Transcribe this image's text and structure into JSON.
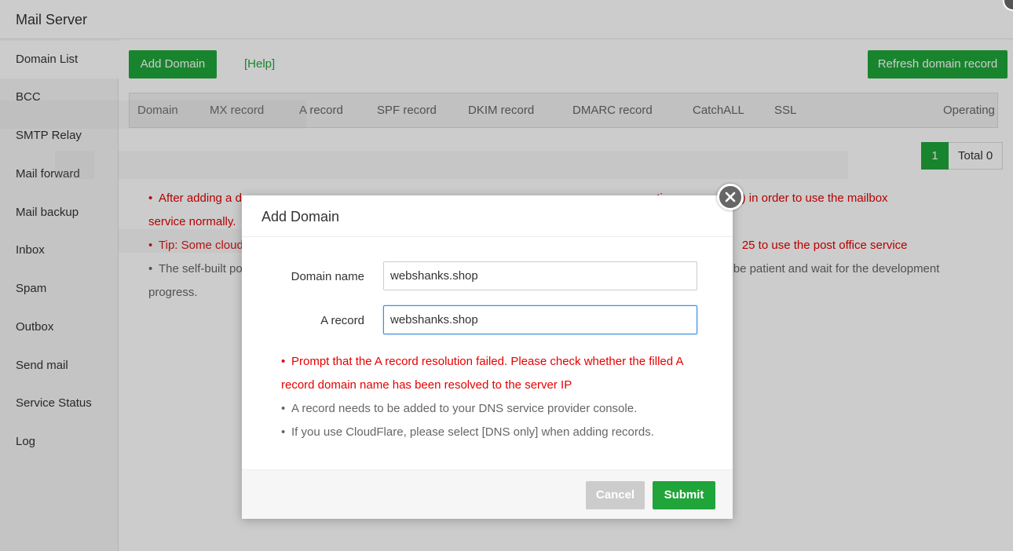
{
  "app": {
    "title": "Mail Server"
  },
  "sidebar": {
    "items": [
      {
        "label": "Domain List"
      },
      {
        "label": "BCC"
      },
      {
        "label": "SMTP Relay"
      },
      {
        "label": "Mail forward"
      },
      {
        "label": "Mail backup"
      },
      {
        "label": "Inbox"
      },
      {
        "label": "Spam"
      },
      {
        "label": "Outbox"
      },
      {
        "label": "Send mail"
      },
      {
        "label": "Service Status"
      },
      {
        "label": "Log"
      }
    ]
  },
  "toolbar": {
    "add_domain_label": "Add Domain",
    "help_label": "[Help]",
    "refresh_label": "Refresh domain record"
  },
  "table": {
    "columns": [
      "Domain",
      "MX record",
      "A record",
      "SPF record",
      "DKIM record",
      "DMARC record",
      "CatchALL",
      "SSL",
      "Operating"
    ]
  },
  "pager": {
    "current": "1",
    "total": "Total 0"
  },
  "page_tips": [
    {
      "text": "After adding a d",
      "tail": "nti-spam services) in order to use the mailbox",
      "cont": "service normally.",
      "color": "red"
    },
    {
      "text": "Tip: Some cloud",
      "tail": "25 to use the post office service",
      "color": "red"
    },
    {
      "text": "The self-built po",
      "tail": "be patient and wait for the development",
      "cont": "progress.",
      "color": "grey"
    }
  ],
  "dialog": {
    "title": "Add Domain",
    "fields": {
      "domain_label": "Domain name",
      "domain_value": "webshanks.shop",
      "arecord_label": "A record",
      "arecord_value": "webshanks.shop"
    },
    "tips": [
      {
        "text": "Prompt that the A record resolution failed. Please check whether the filled A record domain name has been resolved to the server IP",
        "color": "red"
      },
      {
        "text": "A record needs to be added to your DNS service provider console.",
        "color": "grey"
      },
      {
        "text": "If you use CloudFlare, please select [DNS only] when adding records.",
        "color": "grey"
      }
    ],
    "cancel_label": "Cancel",
    "submit_label": "Submit"
  },
  "colors": {
    "accent": "#20a53a",
    "error": "#e50000",
    "overlay": "rgba(0,0,0,0.2)"
  },
  "icons": {
    "dialog_close": "close-circle-icon"
  }
}
